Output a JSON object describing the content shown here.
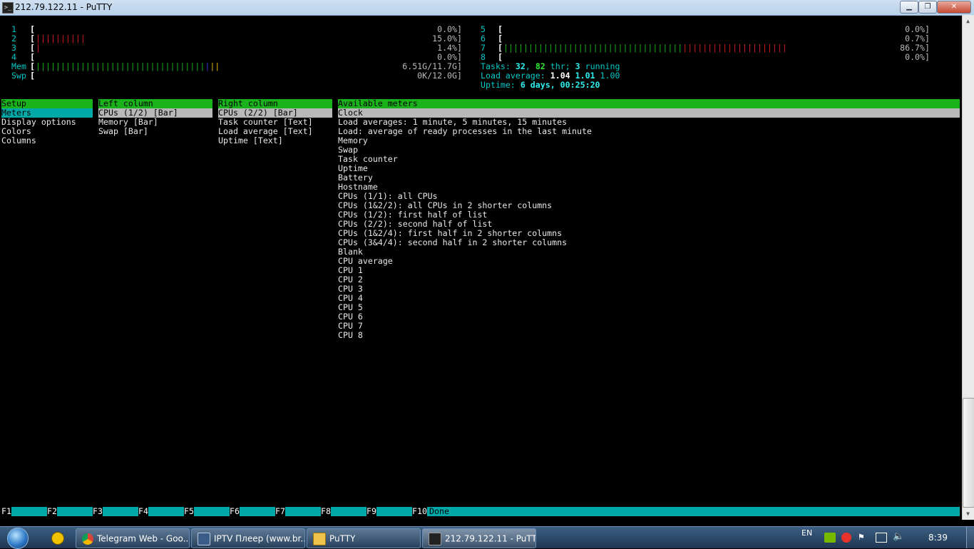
{
  "window": {
    "title": "212.79.122.11 - PuTTY",
    "minimize": "▁",
    "maximize": "❐",
    "close": "✕"
  },
  "cpus_left": [
    {
      "label": "1",
      "value": "0.0%]",
      "fill": 0.0
    },
    {
      "label": "2",
      "value": "15.0%]",
      "fill": 0.15
    },
    {
      "label": "3",
      "value": "1.4%]",
      "fill": 0.014
    },
    {
      "label": "4",
      "value": "0.0%]",
      "fill": 0.0
    }
  ],
  "cpus_right": [
    {
      "label": "5",
      "value": "0.0%]",
      "fill": 0.0
    },
    {
      "label": "6",
      "value": "0.7%]",
      "fill": 0.007
    },
    {
      "label": "7",
      "value": "86.7%]",
      "fill": 0.867
    },
    {
      "label": "8",
      "value": "0.0%]",
      "fill": 0.0
    }
  ],
  "mem": {
    "label": "Mem",
    "value": "6.51G/11.7G]",
    "used": 6.51,
    "total": 11.7
  },
  "swp": {
    "label": "Swp",
    "value": "0K/12.0G]",
    "used": 0,
    "total": 12.0
  },
  "tasks": {
    "prefix": "Tasks: ",
    "count": "32",
    "sep": ", ",
    "threads": "82",
    "thr_label": " thr; ",
    "running": "3",
    "running_label": " running"
  },
  "load": {
    "prefix": "Load average: ",
    "one": "1.04",
    "five": "1.01",
    "fifteen": "1.00"
  },
  "uptime": {
    "prefix": "Uptime: ",
    "value": "6 days, 00:25:20"
  },
  "setup": {
    "header": "Setup",
    "items": [
      "Meters",
      "Display options",
      "Colors",
      "Columns"
    ]
  },
  "left_column": {
    "header": "Left column",
    "items": [
      "CPUs (1/2) [Bar]",
      "Memory [Bar]",
      "Swap [Bar]"
    ]
  },
  "right_column": {
    "header": "Right column",
    "items": [
      "CPUs (2/2) [Bar]",
      "Task counter [Text]",
      "Load average [Text]",
      "Uptime [Text]"
    ]
  },
  "available_meters": {
    "header": "Available meters",
    "items": [
      "Clock",
      "Load averages: 1 minute, 5 minutes, 15 minutes",
      "Load: average of ready processes in the last minute",
      "Memory",
      "Swap",
      "Task counter",
      "Uptime",
      "Battery",
      "Hostname",
      "CPUs (1/1): all CPUs",
      "CPUs (1&2/2): all CPUs in 2 shorter columns",
      "CPUs (1/2): first half of list",
      "CPUs (2/2): second half of list",
      "CPUs (1&2/4): first half in 2 shorter columns",
      "CPUs (3&4/4): second half in 2 shorter columns",
      "Blank",
      "CPU average",
      "CPU 1",
      "CPU 2",
      "CPU 3",
      "CPU 4",
      "CPU 5",
      "CPU 6",
      "CPU 7",
      "CPU 8"
    ]
  },
  "function_keys": [
    {
      "key": "F1",
      "label": ""
    },
    {
      "key": "F2",
      "label": ""
    },
    {
      "key": "F3",
      "label": ""
    },
    {
      "key": "F4",
      "label": ""
    },
    {
      "key": "F5",
      "label": ""
    },
    {
      "key": "F6",
      "label": ""
    },
    {
      "key": "F7",
      "label": ""
    },
    {
      "key": "F8",
      "label": ""
    },
    {
      "key": "F9",
      "label": ""
    },
    {
      "key": "F10",
      "label": "Done"
    }
  ],
  "taskbar": {
    "items": [
      {
        "label": "Telegram Web - Goo...",
        "icon": "chrome-icon"
      },
      {
        "label": "IPTV Плеер (www.br...",
        "icon": "iptv-icon"
      },
      {
        "label": "PuTTY",
        "icon": "folder-icon"
      },
      {
        "label": "212.79.122.11 - PuTTY",
        "icon": "putty-icon"
      }
    ],
    "language": "EN",
    "clock": "8:39"
  },
  "colors": {
    "header_green": "#1ab21a",
    "selection_cyan": "#00a8a8",
    "selection_gray": "#b8b8b8",
    "bar_red": "#d01a1a",
    "bar_green": "#1ab21a"
  }
}
